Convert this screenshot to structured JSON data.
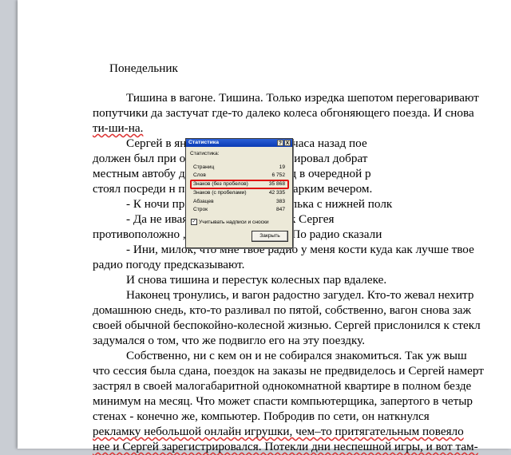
{
  "document": {
    "heading": "Понедельник",
    "lines": [
      "Тишина в вагоне. Тишина. Только изредка шепотом переговаривают",
      "попутчики да застучат где-то далеко колеса обгоняющего поезда. И снова",
      "ти-ши-на.",
      "Сергей в                                     янул на часы. Еще два часа назад пое",
      "должен был при                                        ок, с которого он планировал добрат",
      "местным автобу                                        днако… Однако, поезд в очередной р",
      "стоял посреди н                                       полей августовским жарким вечером.",
      "- К ночи пр                                      итетно заявила бабулька с нижней полк",
      "- Да  не                                          иваясь,  ответил  ровесник  Сергея",
      "противоположно                                        , это да. Но не будет. По радио сказали",
      "- Ини, милок, что мне твое радио у меня кости куда как лучше твое",
      "радио погоду предсказывают.",
      "И снова тишина и перестук колесных пар вдалеке.",
      "Наконец тронулись, и вагон радостно загудел. Кто-то жевал нехитр",
      "домашнюю снедь, кто-то разливал по пятой, собственно, вагон снова заж",
      "своей обычной беспокойно-колесной жизнью. Сергей прислонился к стекл",
      "задумался о том, что же подвигло его на эту поездку.",
      "Собственно, ни с кем он и не собирался знакомиться. Так уж выш",
      "что сессия была сдана, поездок на заказы не предвиделось и Сергей намерт",
      "застрял в своей малогабаритной однокомнатной квартире в полном безде",
      "минимум на месяц. Что может спасти компьютерщика, запертого в четыр",
      "стенах  -  конечно  же,  компьютер.  Побродив  по  сети,  он  наткнулся",
      "рекламку небольшой онлайн игрушки, чем–то притягательным повеяло",
      "нее и Сергей зарегистрировался. Потекли дни неспешной игры, и вот там-"
    ]
  },
  "dialog": {
    "title": "Статистика",
    "help_glyph": "?",
    "close_glyph": "X",
    "section_label": "Статистика:",
    "rows": [
      {
        "label": "Страниц",
        "value": "19"
      },
      {
        "label": "Слов",
        "value": "6 752"
      },
      {
        "label": "Знаков (без пробелов)",
        "value": "35 868"
      },
      {
        "label": "Знаков (с пробелами)",
        "value": "42 335"
      },
      {
        "label": "Абзацев",
        "value": "383"
      },
      {
        "label": "Строк",
        "value": "847"
      }
    ],
    "checkbox_label": "Учитывать надписи и сноски",
    "checkbox_checked": "✓",
    "close_button": "Закрыть"
  }
}
